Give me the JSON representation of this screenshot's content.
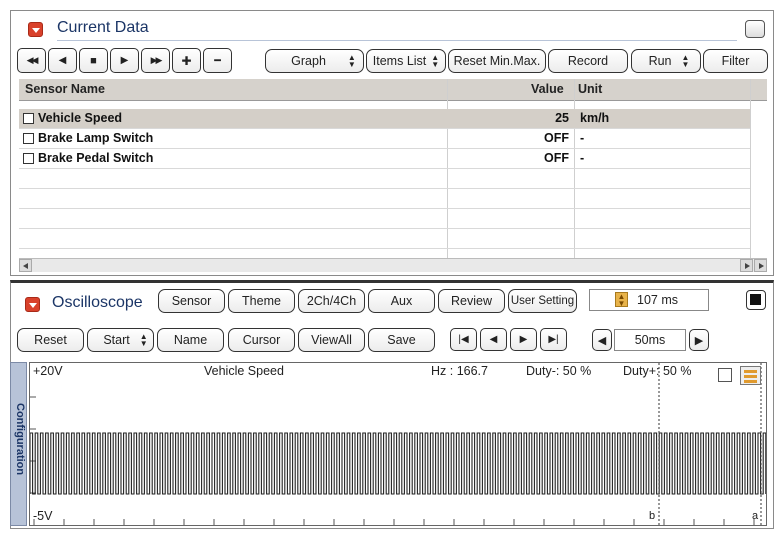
{
  "current_data": {
    "title": "Current Data",
    "toolbar": {
      "rewind_icon": "◀◀",
      "prev_icon": "◀",
      "stop_icon": "■",
      "play_icon": "▶",
      "forward_icon": "▶▶",
      "add_icon": "✚",
      "remove_icon": "━",
      "graph": "Graph",
      "items_list": "Items List",
      "reset_min_max": "Reset Min.Max.",
      "record": "Record",
      "run": "Run",
      "filter": "Filter"
    },
    "table": {
      "columns": [
        "Sensor Name",
        "Value",
        "Unit"
      ],
      "rows": [
        {
          "name": "Vehicle Speed",
          "value": "25",
          "unit": "km/h"
        },
        {
          "name": "Brake Lamp Switch",
          "value": "OFF",
          "unit": "-"
        },
        {
          "name": "Brake Pedal Switch",
          "value": "OFF",
          "unit": "-"
        }
      ]
    }
  },
  "oscilloscope": {
    "title": "Oscilloscope",
    "buttons": {
      "sensor": "Sensor",
      "theme": "Theme",
      "channels": "2Ch/4Ch",
      "aux": "Aux",
      "review": "Review",
      "user_setting": "User Setting",
      "reset": "Reset",
      "start": "Start",
      "name": "Name",
      "cursor": "Cursor",
      "view_all": "ViewAll",
      "save": "Save"
    },
    "sample_time": "107 ms",
    "timebase": "50ms",
    "config_tab": "Configuration",
    "graph": {
      "top_voltage": "+20V",
      "bottom_voltage": "-5V",
      "channel_name": "Vehicle Speed",
      "hz": "Hz  : 166.7",
      "duty_minus": "Duty-: 50 %",
      "duty_plus": "Duty+: 50 %",
      "cursor_b": "b",
      "cursor_a": "a"
    }
  }
}
